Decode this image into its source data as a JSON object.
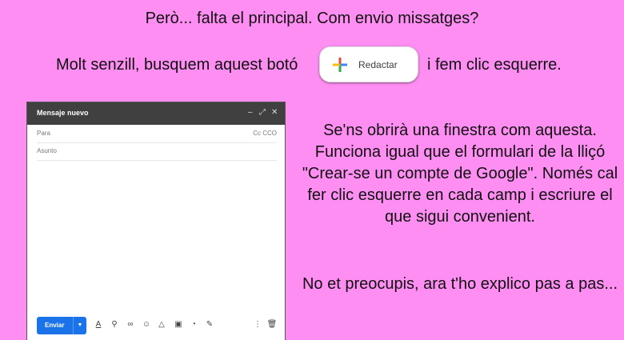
{
  "text": {
    "line1": "Però... falta el principal. Com envio missatges?",
    "line2_pre": "Molt senzill, busquem aquest botó",
    "line2_post": "i fem clic esquerre.",
    "desc": "Se'ns obrirà una finestra com aquesta. Funciona igual que el formulari de la lliçó \"Crear-se un compte de Google\". Només cal fer clic esquerre en cada camp i escriure el que sigui convenient.",
    "desc2": "No et preocupis, ara t'ho explico pas a pas..."
  },
  "compose_button": {
    "label": "Redactar",
    "icon": "google-plus-icon"
  },
  "compose_window": {
    "title": "Mensaje nuevo",
    "controls": [
      "minimize-icon",
      "expand-icon",
      "close-icon"
    ],
    "to_label": "Para",
    "cc_label": "Cc CCO",
    "subject_label": "Asunto",
    "send_label": "Enviar",
    "send_options_icon": "caret-down-icon",
    "toolbar_icons": [
      "format-text-icon",
      "attach-icon",
      "link-icon",
      "emoji-icon",
      "drive-icon",
      "photo-icon",
      "lock-clock-icon",
      "pen-icon",
      "more-icon",
      "trash-icon"
    ]
  },
  "colors": {
    "background": "#ff8ef3",
    "send_button": "#1a73e8",
    "window_header": "#404040"
  }
}
